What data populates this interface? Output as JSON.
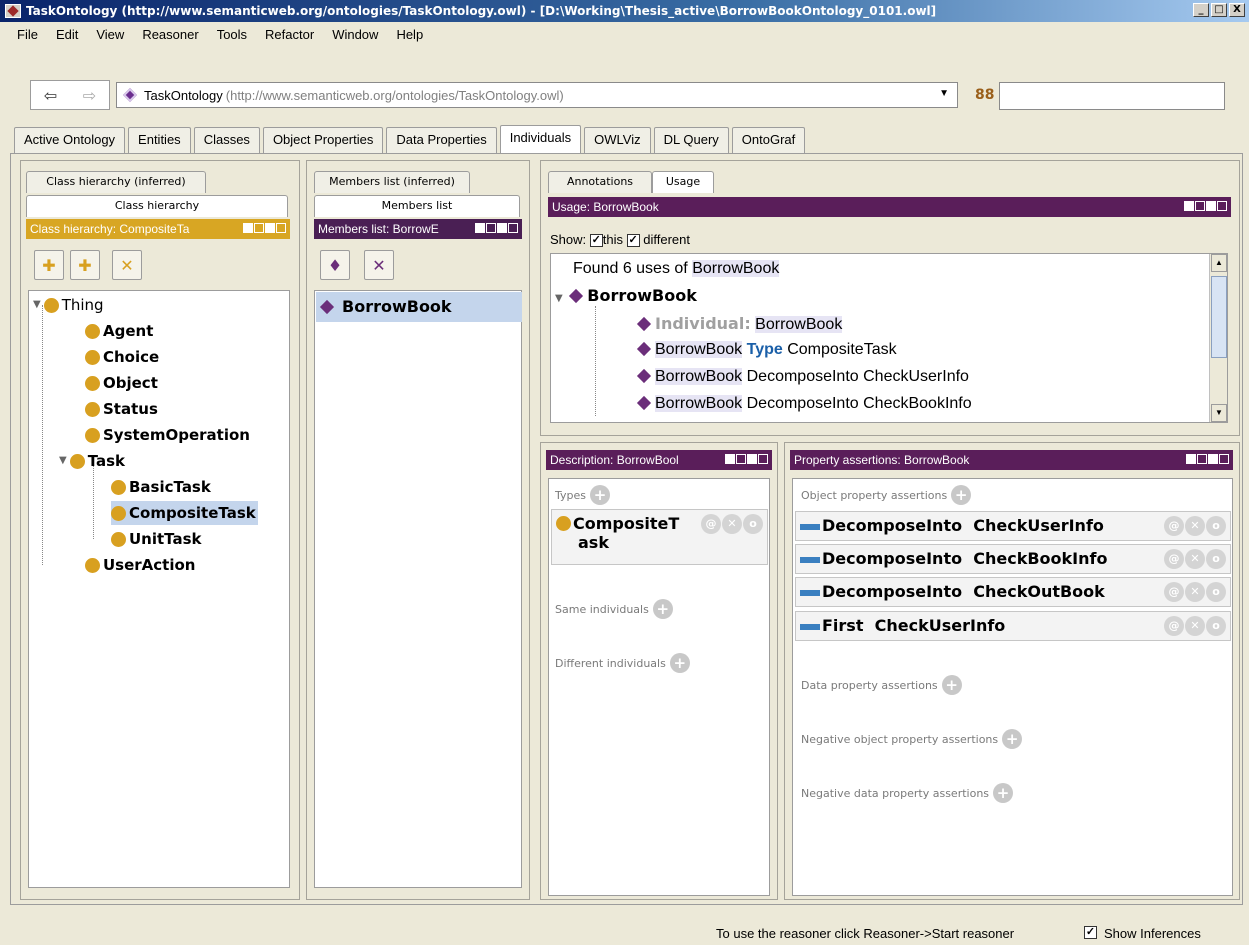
{
  "window": {
    "title": "TaskOntology (http://www.semanticweb.org/ontologies/TaskOntology.owl) - [D:\\Working\\Thesis_active\\BorrowBookOntology_0101.owl]",
    "minimize": "_",
    "maximize": "□",
    "close": "X"
  },
  "menu": [
    "File",
    "Edit",
    "View",
    "Reasoner",
    "Tools",
    "Refactor",
    "Window",
    "Help"
  ],
  "toolbar": {
    "back_icon": "⇦",
    "forward_icon": "⇨",
    "ontology_name": "TaskOntology",
    "ontology_iri": "(http://www.semanticweb.org/ontologies/TaskOntology.owl)",
    "combo_arrow": "▼",
    "search_icon": "88",
    "search_value": ""
  },
  "tabs": [
    "Active Ontology",
    "Entities",
    "Classes",
    "Object Properties",
    "Data Properties",
    "Individuals",
    "OWLViz",
    "DL Query",
    "OntoGraf"
  ],
  "class_panel": {
    "tab_inferred": "Class hierarchy (inferred)",
    "tab_asserted": "Class hierarchy",
    "header": "Class hierarchy: CompositeTa",
    "tree": [
      {
        "label": "Thing",
        "bold": false
      },
      {
        "label": "Agent"
      },
      {
        "label": "Choice"
      },
      {
        "label": "Object"
      },
      {
        "label": "Status"
      },
      {
        "label": "SystemOperation"
      },
      {
        "label": "Task"
      },
      {
        "label": "BasicTask"
      },
      {
        "label": "CompositeTask"
      },
      {
        "label": "UnitTask"
      },
      {
        "label": "UserAction"
      }
    ]
  },
  "members_panel": {
    "tab_inferred": "Members list (inferred)",
    "tab_asserted": "Members list",
    "header": "Members list: BorrowE",
    "items": [
      "BorrowBook"
    ]
  },
  "usage_panel": {
    "tab_annotations": "Annotations",
    "tab_usage": "Usage",
    "header": "Usage: BorrowBook",
    "show_label": "Show:",
    "this_label": "this",
    "different_label": "different",
    "found_prefix": "Found 6 uses of ",
    "found_subject": "BorrowBook",
    "root": "BorrowBook",
    "rows": [
      {
        "a": "Individual:",
        "b": "BorrowBook"
      },
      {
        "subj": "BorrowBook",
        "kw": "Type",
        "obj": "CompositeTask"
      },
      {
        "subj": "BorrowBook",
        "prop": "DecomposeInto",
        "obj": "CheckUserInfo"
      },
      {
        "subj": "BorrowBook",
        "prop": "DecomposeInto",
        "obj": "CheckBookInfo"
      }
    ]
  },
  "description_panel": {
    "header": "Description: BorrowBool",
    "types_label": "Types",
    "type_value_1": "CompositeT",
    "type_value_2": "ask",
    "same_label": "Same individuals",
    "different_label": "Different individuals"
  },
  "property_panel": {
    "header": "Property assertions: BorrowBook",
    "object_label": "Object property assertions",
    "assertions": [
      {
        "prop": "DecomposeInto",
        "value": "CheckUserInfo"
      },
      {
        "prop": "DecomposeInto",
        "value": "CheckBookInfo"
      },
      {
        "prop": "DecomposeInto",
        "value": "CheckOutBook"
      },
      {
        "prop": "First",
        "value": "CheckUserInfo"
      }
    ],
    "data_label": "Data property assertions",
    "neg_object_label": "Negative object property assertions",
    "neg_data_label": "Negative data property assertions"
  },
  "status": {
    "message": "To use the reasoner click Reasoner->Start reasoner",
    "show_inferences": "Show Inferences"
  },
  "colors": {
    "class_dot": "#d8a020",
    "individual": "#6b2e7a",
    "panel_header_gold": "#d8a623",
    "panel_header_purple": "#5a1e5a",
    "keyword_blue": "#1a5fa8"
  }
}
